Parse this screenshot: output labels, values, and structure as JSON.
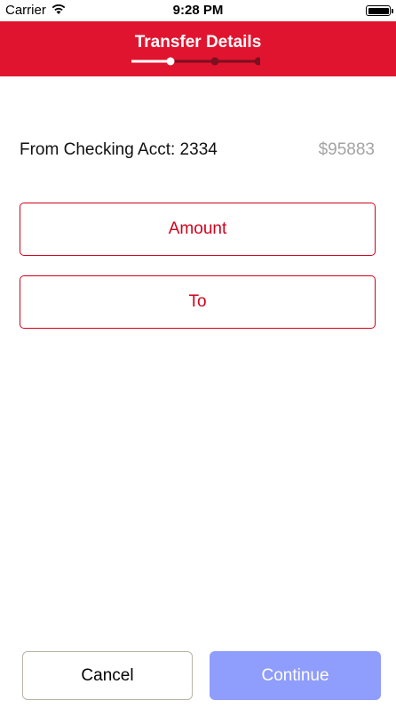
{
  "status_bar": {
    "carrier": "Carrier",
    "time": "9:28 PM",
    "icons": [
      "wifi-icon",
      "battery-icon"
    ]
  },
  "header": {
    "title": "Transfer Details",
    "background_color": "#e0142f",
    "stepper": {
      "total_steps": 3,
      "current_step": 1
    }
  },
  "account": {
    "label": "From Checking Acct: 2334",
    "balance": "$95883"
  },
  "fields": {
    "amount_label": "Amount",
    "to_label": "To",
    "accent_color": "#d0021b"
  },
  "footer": {
    "cancel_label": "Cancel",
    "continue_label": "Continue",
    "continue_color": "#8f9dfc"
  }
}
